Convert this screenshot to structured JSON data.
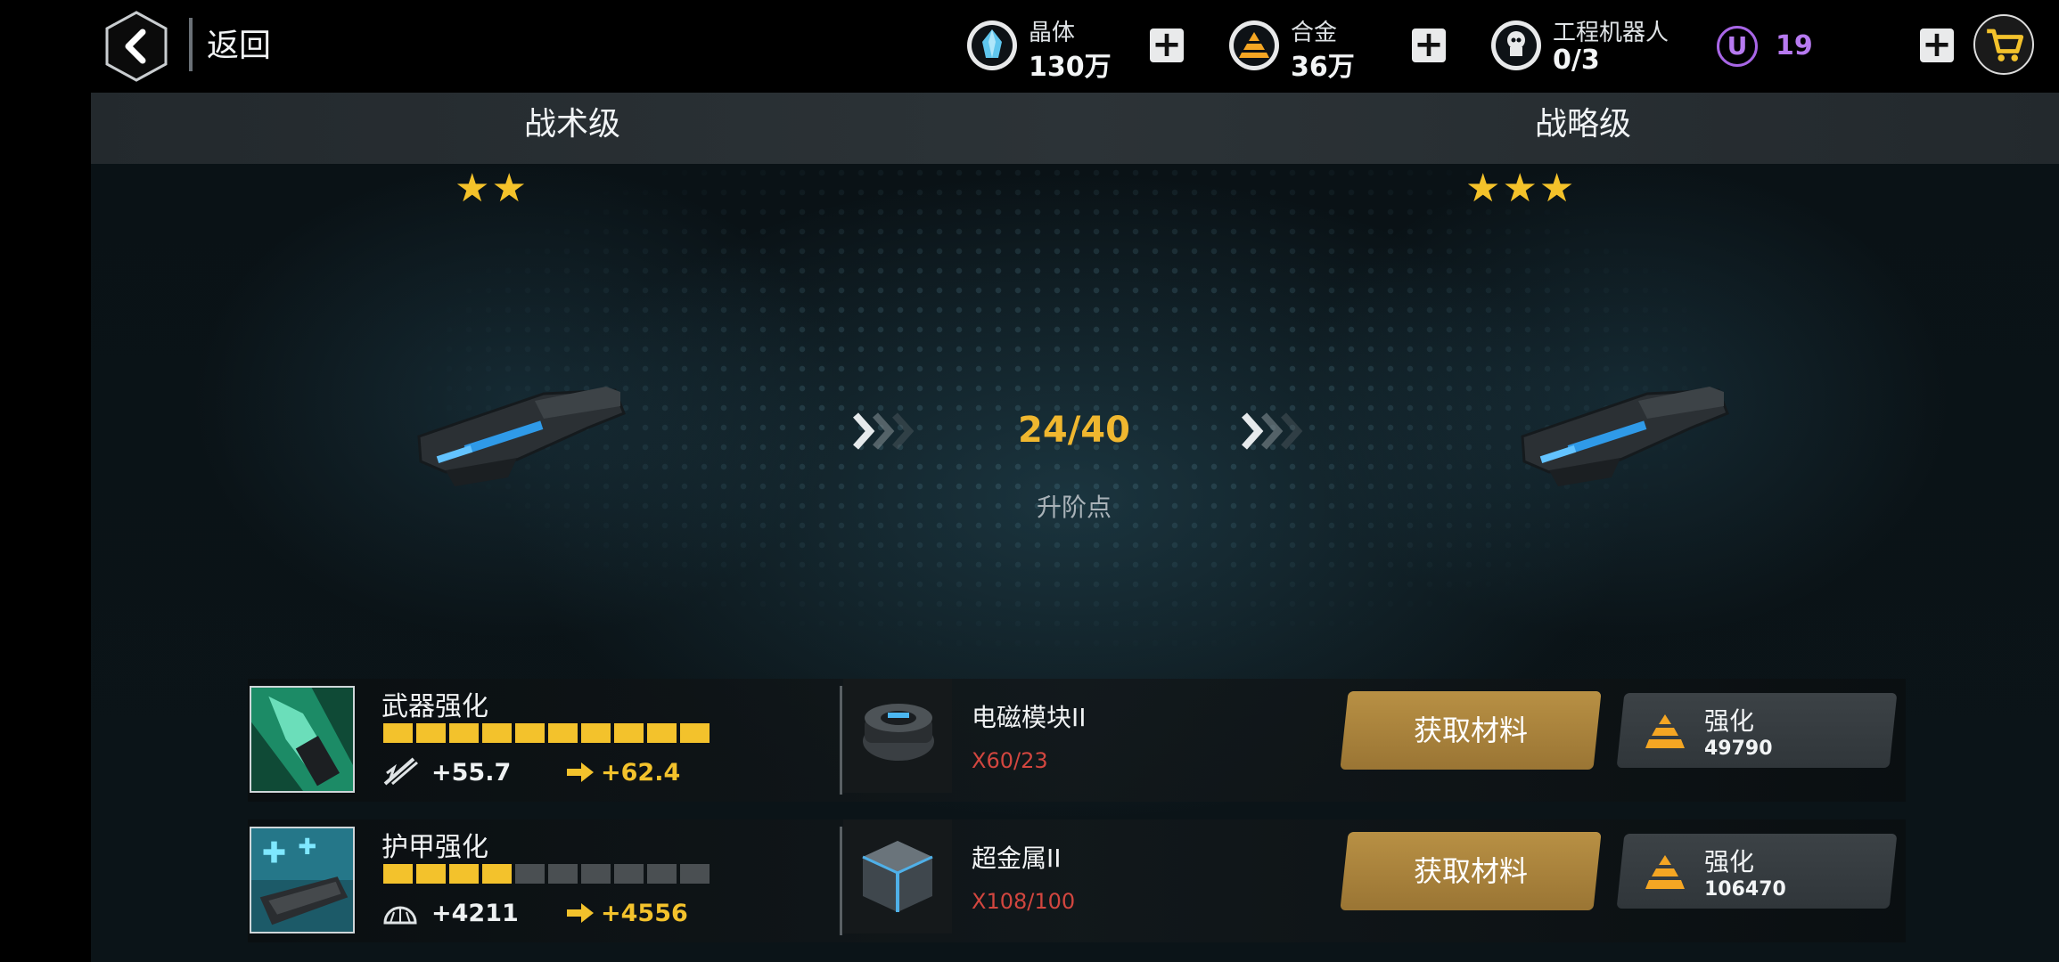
{
  "header": {
    "back_label": "返回",
    "resources": [
      {
        "name": "晶体",
        "value": "130万",
        "icon": "crystal-icon"
      },
      {
        "name": "合金",
        "value": "36万",
        "icon": "alloy-icon"
      },
      {
        "name": "工程机器人",
        "value": "0/3",
        "icon": "robot-icon"
      }
    ],
    "u_badge": "U",
    "u_count": "19",
    "accent_gold": "#f3c22c",
    "accent_purple": "#b77af0"
  },
  "tiers": {
    "left": {
      "title": "战术级",
      "stars": "★★",
      "star_count": 2
    },
    "right": {
      "title": "战略级",
      "stars": "★★★",
      "star_count": 3
    }
  },
  "promotion": {
    "value": "24/40",
    "label": "升阶点"
  },
  "upgrades": [
    {
      "name": "武器强化",
      "level_filled": 10,
      "level_total": 10,
      "stat_icon": "weapon-damage-icon",
      "current": "+55.7",
      "next": "+62.4",
      "material_name": "电磁模块II",
      "material_count": "X60/23",
      "get_label": "获取材料",
      "upgrade_label": "强化",
      "upgrade_cost": "49790"
    },
    {
      "name": "护甲强化",
      "level_filled": 4,
      "level_total": 10,
      "stat_icon": "armor-icon",
      "current": "+4211",
      "next": "+4556",
      "material_name": "超金属II",
      "material_count": "X108/100",
      "get_label": "获取材料",
      "upgrade_label": "强化",
      "upgrade_cost": "106470"
    }
  ]
}
